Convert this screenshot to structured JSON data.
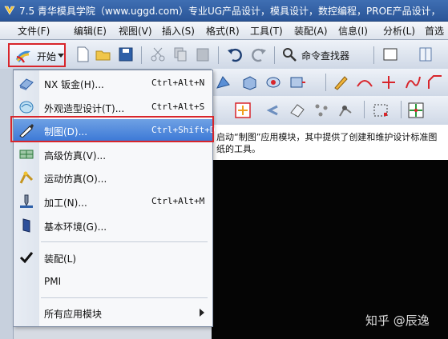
{
  "window": {
    "title": "7.5 青华模具学院（www.uggd.com）专业UG产品设计，模具设计，数控编程，PROE产品设计，"
  },
  "menubar": {
    "items": [
      "文件(F)",
      "编辑(E)",
      "视图(V)",
      "插入(S)",
      "格式(R)",
      "工具(T)",
      "装配(A)",
      "信息(I)",
      "分析(L)",
      "首选"
    ]
  },
  "toolbar": {
    "start_label": "开始",
    "command_finder_label": "命令查找器"
  },
  "start_menu": {
    "items": [
      {
        "label": "NX 钣金(H)...",
        "shortcut": "Ctrl+Alt+N",
        "icon": "sheet-metal-icon"
      },
      {
        "label": "外观造型设计(T)...",
        "shortcut": "Ctrl+Alt+S",
        "icon": "shape-studio-icon"
      },
      {
        "label": "制图(D)...",
        "shortcut": "Ctrl+Shift+D",
        "icon": "drafting-icon",
        "highlighted": true
      },
      {
        "label": "高级仿真(V)...",
        "shortcut": "",
        "icon": "advanced-simulation-icon"
      },
      {
        "label": "运动仿真(O)...",
        "shortcut": "",
        "icon": "motion-simulation-icon"
      },
      {
        "label": "加工(N)...",
        "shortcut": "Ctrl+Alt+M",
        "icon": "manufacturing-icon"
      },
      {
        "label": "基本环境(G)...",
        "shortcut": "",
        "icon": "gateway-icon"
      },
      {
        "label": "装配(L)",
        "shortcut": "",
        "icon": "checkmark-icon"
      },
      {
        "label": "PMI",
        "shortcut": "",
        "icon": ""
      },
      {
        "label": "所有应用模块",
        "shortcut": "",
        "icon": ""
      }
    ]
  },
  "hint": {
    "text": "启动“制图”应用模块，其中提供了创建和维护设计标准图纸的工具。"
  },
  "watermark": {
    "text": "知乎 @辰逸"
  },
  "colors": {
    "highlight": "#d8252b",
    "selection": "#3b78d6"
  }
}
